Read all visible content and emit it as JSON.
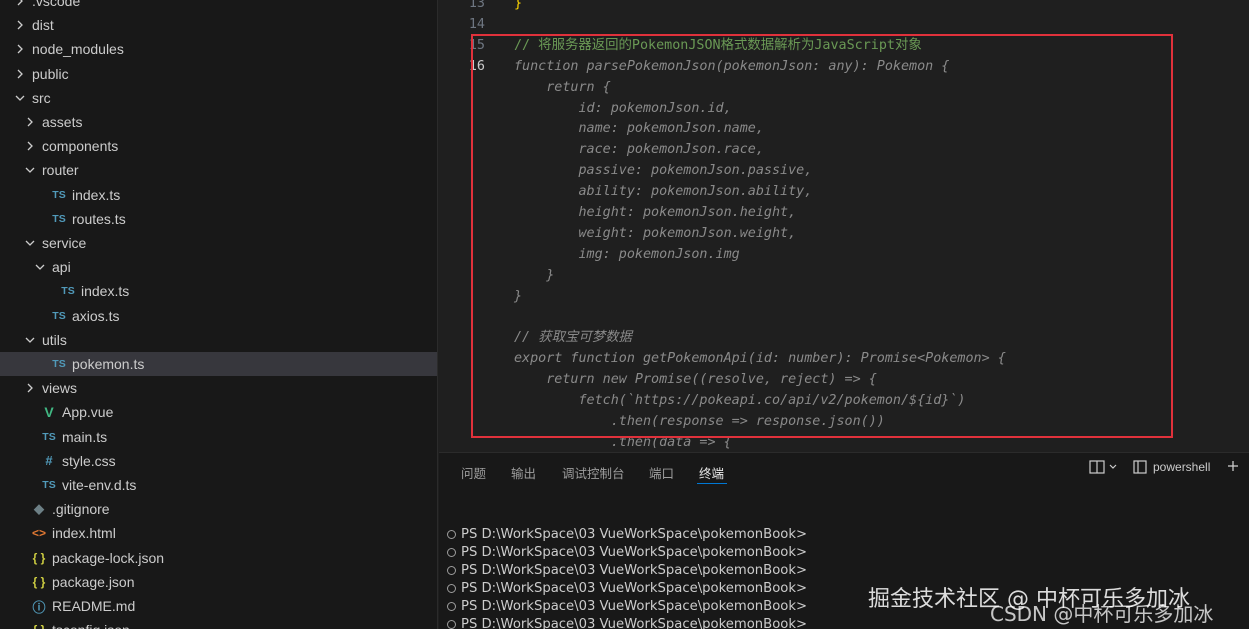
{
  "explorer": {
    "items": [
      {
        "label": ".vscode",
        "kind": "folder",
        "state": "closed",
        "level": 0
      },
      {
        "label": "dist",
        "kind": "folder",
        "state": "closed",
        "level": 0
      },
      {
        "label": "node_modules",
        "kind": "folder",
        "state": "closed",
        "level": 0
      },
      {
        "label": "public",
        "kind": "folder",
        "state": "closed",
        "level": 0
      },
      {
        "label": "src",
        "kind": "folder",
        "state": "open",
        "level": 0
      },
      {
        "label": "assets",
        "kind": "folder",
        "state": "closed",
        "level": 1
      },
      {
        "label": "components",
        "kind": "folder",
        "state": "closed",
        "level": 1
      },
      {
        "label": "router",
        "kind": "folder",
        "state": "open",
        "level": 1
      },
      {
        "label": "index.ts",
        "kind": "ts",
        "level": 2
      },
      {
        "label": "routes.ts",
        "kind": "ts",
        "level": 2
      },
      {
        "label": "service",
        "kind": "folder",
        "state": "open",
        "level": 1
      },
      {
        "label": "api",
        "kind": "folder",
        "state": "open",
        "level": 2
      },
      {
        "label": "index.ts",
        "kind": "ts",
        "level": 3
      },
      {
        "label": "axios.ts",
        "kind": "ts",
        "level": 2
      },
      {
        "label": "utils",
        "kind": "folder",
        "state": "open",
        "level": 1
      },
      {
        "label": "pokemon.ts",
        "kind": "ts",
        "level": 2,
        "selected": true
      },
      {
        "label": "views",
        "kind": "folder",
        "state": "closed",
        "level": 1
      },
      {
        "label": "App.vue",
        "kind": "vue",
        "level": 1
      },
      {
        "label": "main.ts",
        "kind": "ts",
        "level": 1
      },
      {
        "label": "style.css",
        "kind": "css",
        "level": 1
      },
      {
        "label": "vite-env.d.ts",
        "kind": "ts",
        "level": 1
      },
      {
        "label": ".gitignore",
        "kind": "git",
        "level": 0
      },
      {
        "label": "index.html",
        "kind": "html",
        "level": 0
      },
      {
        "label": "package-lock.json",
        "kind": "json",
        "level": 0
      },
      {
        "label": "package.json",
        "kind": "json",
        "level": 0
      },
      {
        "label": "README.md",
        "kind": "info",
        "level": 0
      },
      {
        "label": "tsconfig.json",
        "kind": "json",
        "level": 0
      }
    ],
    "icons": {
      "ts": "TS",
      "vue": "V",
      "css": "#",
      "git": "◆",
      "html": "<>",
      "json": "{ }",
      "info": "ⓘ"
    }
  },
  "editor": {
    "active_line": 16,
    "lines": [
      {
        "num": "13",
        "text": "}",
        "style": "brace"
      },
      {
        "num": "14",
        "text": "",
        "style": "dim"
      },
      {
        "num": "15",
        "text": "// 将服务器返回的PokemonJSON格式数据解析为JavaScript对象",
        "style": "comment"
      },
      {
        "num": "16",
        "text": "function parsePokemonJson(pokemonJson: any): Pokemon {",
        "style": "dim"
      },
      {
        "num": "",
        "text": "    return {",
        "style": "dim"
      },
      {
        "num": "",
        "text": "        id: pokemonJson.id,",
        "style": "dim"
      },
      {
        "num": "",
        "text": "        name: pokemonJson.name,",
        "style": "dim"
      },
      {
        "num": "",
        "text": "        race: pokemonJson.race,",
        "style": "dim"
      },
      {
        "num": "",
        "text": "        passive: pokemonJson.passive,",
        "style": "dim"
      },
      {
        "num": "",
        "text": "        ability: pokemonJson.ability,",
        "style": "dim"
      },
      {
        "num": "",
        "text": "        height: pokemonJson.height,",
        "style": "dim"
      },
      {
        "num": "",
        "text": "        weight: pokemonJson.weight,",
        "style": "dim"
      },
      {
        "num": "",
        "text": "        img: pokemonJson.img",
        "style": "dim"
      },
      {
        "num": "",
        "text": "    }",
        "style": "dim"
      },
      {
        "num": "",
        "text": "}",
        "style": "dim"
      },
      {
        "num": "",
        "text": "",
        "style": "dim"
      },
      {
        "num": "",
        "text": "// 获取宝可梦数据",
        "style": "dim"
      },
      {
        "num": "",
        "text": "export function getPokemonApi(id: number): Promise<Pokemon> {",
        "style": "dim"
      },
      {
        "num": "",
        "text": "    return new Promise((resolve, reject) => {",
        "style": "dim"
      },
      {
        "num": "",
        "text": "        fetch(`https://pokeapi.co/api/v2/pokemon/${id}`)",
        "style": "dim"
      },
      {
        "num": "",
        "text": "            .then(response => response.json())",
        "style": "dim"
      },
      {
        "num": "",
        "text": "            .then(data => {",
        "style": "dim"
      }
    ]
  },
  "panel": {
    "tabs": [
      "问题",
      "输出",
      "调试控制台",
      "端口",
      "终端"
    ],
    "active_tab": 4,
    "terminal_name": "powershell",
    "terminal_lines": [
      "PS D:\\WorkSpace\\03 VueWorkSpace\\pokemonBook>",
      "PS D:\\WorkSpace\\03 VueWorkSpace\\pokemonBook>",
      "PS D:\\WorkSpace\\03 VueWorkSpace\\pokemonBook>",
      "PS D:\\WorkSpace\\03 VueWorkSpace\\pokemonBook>",
      "PS D:\\WorkSpace\\03 VueWorkSpace\\pokemonBook>",
      "PS D:\\WorkSpace\\03 VueWorkSpace\\pokemonBook>"
    ]
  },
  "watermarks": {
    "primary": "掘金技术社区 @ 中杯可乐多加冰",
    "secondary": "CSDN @中杯可乐多加冰"
  },
  "colors": {
    "highlight_box": "#e0313b",
    "accent": "#0078d4",
    "comment": "#6a9955"
  }
}
